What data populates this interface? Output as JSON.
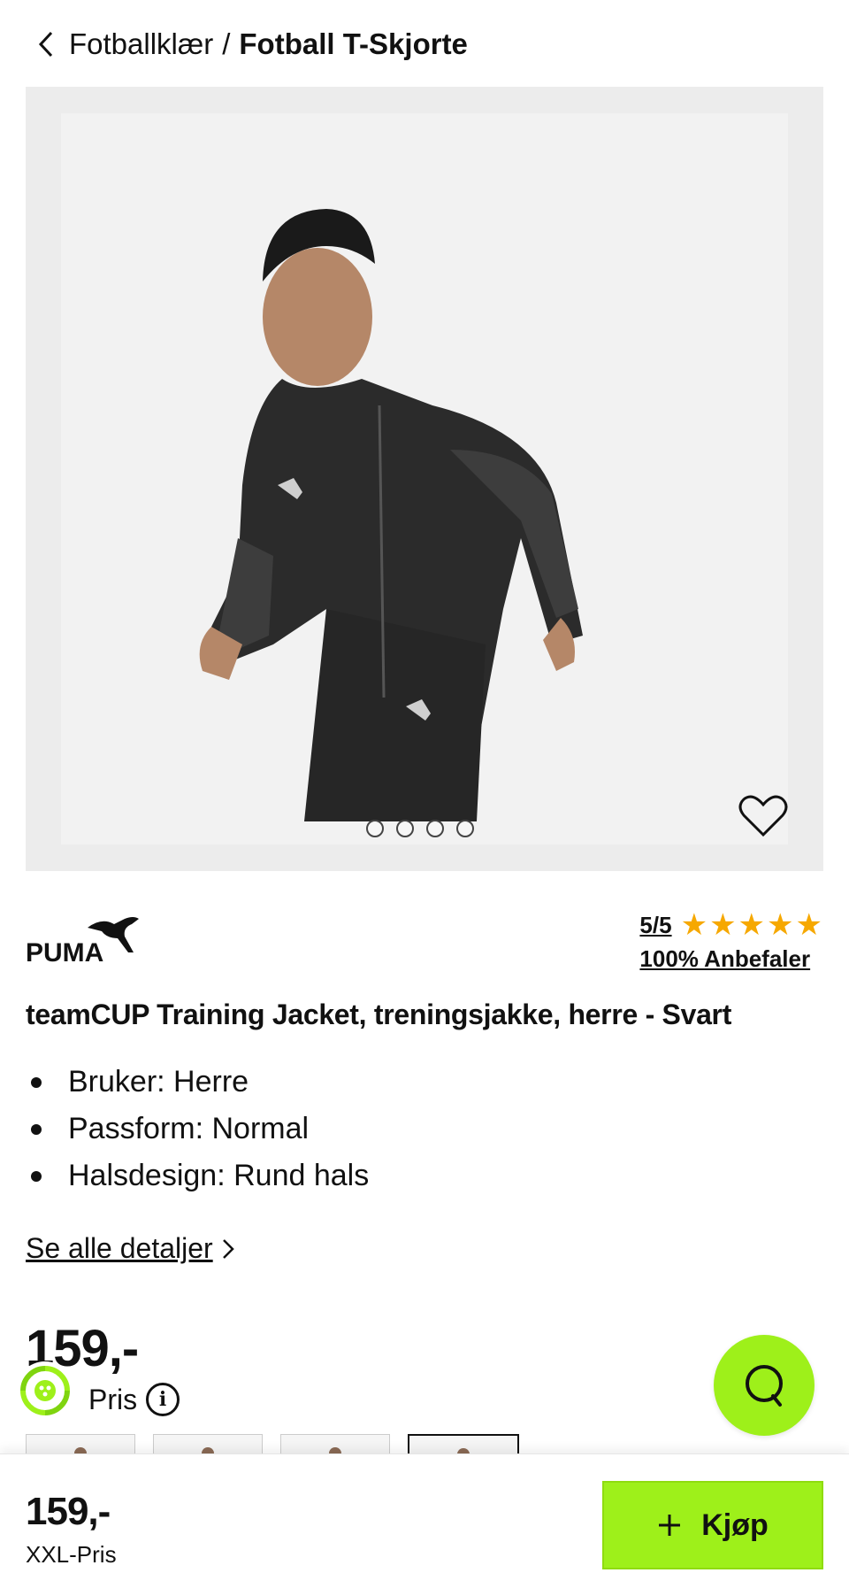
{
  "breadcrumb": {
    "parent": "Fotballklær",
    "separator": "/",
    "current": "Fotball T-Skjorte"
  },
  "product_image": {
    "description_icon": "product-photo",
    "dots_count": 4
  },
  "brand": {
    "name": "PUMA"
  },
  "rating": {
    "score": "5/5",
    "stars": 5,
    "recommend": "100% Anbefaler",
    "star_color": "#f6a800"
  },
  "product": {
    "title": "teamCUP Training Jacket, treningsjakke, herre - Svart",
    "specs": [
      "Bruker: Herre",
      "Passform: Normal",
      "Halsdesign: Rund hals"
    ],
    "details_link": "Se alle detaljer"
  },
  "price": {
    "amount": "159,-",
    "label": "Pris"
  },
  "bottom_bar": {
    "price": "159,-",
    "price_label": "XXL-Pris",
    "buy_label": "Kjøp",
    "accent": "#9ef01a"
  }
}
